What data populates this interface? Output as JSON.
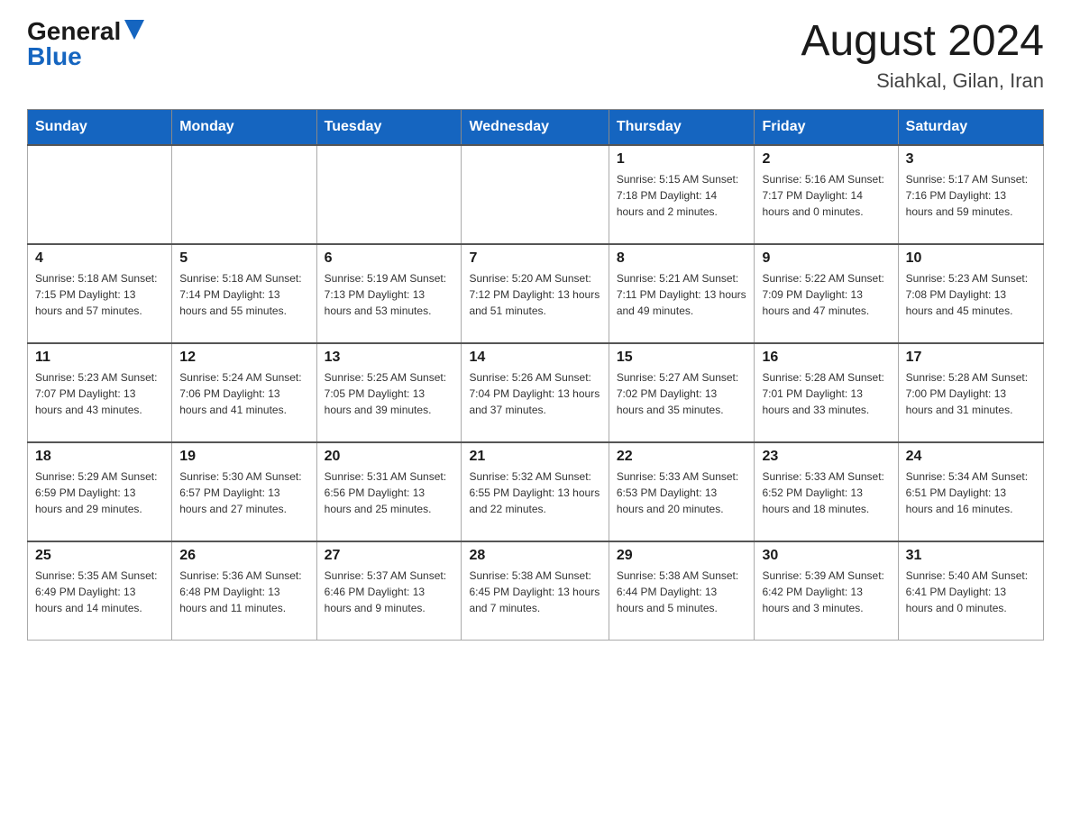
{
  "header": {
    "logo": {
      "general": "General",
      "blue": "Blue"
    },
    "title": "August 2024",
    "location": "Siahkal, Gilan, Iran"
  },
  "days_of_week": [
    "Sunday",
    "Monday",
    "Tuesday",
    "Wednesday",
    "Thursday",
    "Friday",
    "Saturday"
  ],
  "weeks": [
    [
      {
        "day": "",
        "info": ""
      },
      {
        "day": "",
        "info": ""
      },
      {
        "day": "",
        "info": ""
      },
      {
        "day": "",
        "info": ""
      },
      {
        "day": "1",
        "info": "Sunrise: 5:15 AM\nSunset: 7:18 PM\nDaylight: 14 hours\nand 2 minutes."
      },
      {
        "day": "2",
        "info": "Sunrise: 5:16 AM\nSunset: 7:17 PM\nDaylight: 14 hours\nand 0 minutes."
      },
      {
        "day": "3",
        "info": "Sunrise: 5:17 AM\nSunset: 7:16 PM\nDaylight: 13 hours\nand 59 minutes."
      }
    ],
    [
      {
        "day": "4",
        "info": "Sunrise: 5:18 AM\nSunset: 7:15 PM\nDaylight: 13 hours\nand 57 minutes."
      },
      {
        "day": "5",
        "info": "Sunrise: 5:18 AM\nSunset: 7:14 PM\nDaylight: 13 hours\nand 55 minutes."
      },
      {
        "day": "6",
        "info": "Sunrise: 5:19 AM\nSunset: 7:13 PM\nDaylight: 13 hours\nand 53 minutes."
      },
      {
        "day": "7",
        "info": "Sunrise: 5:20 AM\nSunset: 7:12 PM\nDaylight: 13 hours\nand 51 minutes."
      },
      {
        "day": "8",
        "info": "Sunrise: 5:21 AM\nSunset: 7:11 PM\nDaylight: 13 hours\nand 49 minutes."
      },
      {
        "day": "9",
        "info": "Sunrise: 5:22 AM\nSunset: 7:09 PM\nDaylight: 13 hours\nand 47 minutes."
      },
      {
        "day": "10",
        "info": "Sunrise: 5:23 AM\nSunset: 7:08 PM\nDaylight: 13 hours\nand 45 minutes."
      }
    ],
    [
      {
        "day": "11",
        "info": "Sunrise: 5:23 AM\nSunset: 7:07 PM\nDaylight: 13 hours\nand 43 minutes."
      },
      {
        "day": "12",
        "info": "Sunrise: 5:24 AM\nSunset: 7:06 PM\nDaylight: 13 hours\nand 41 minutes."
      },
      {
        "day": "13",
        "info": "Sunrise: 5:25 AM\nSunset: 7:05 PM\nDaylight: 13 hours\nand 39 minutes."
      },
      {
        "day": "14",
        "info": "Sunrise: 5:26 AM\nSunset: 7:04 PM\nDaylight: 13 hours\nand 37 minutes."
      },
      {
        "day": "15",
        "info": "Sunrise: 5:27 AM\nSunset: 7:02 PM\nDaylight: 13 hours\nand 35 minutes."
      },
      {
        "day": "16",
        "info": "Sunrise: 5:28 AM\nSunset: 7:01 PM\nDaylight: 13 hours\nand 33 minutes."
      },
      {
        "day": "17",
        "info": "Sunrise: 5:28 AM\nSunset: 7:00 PM\nDaylight: 13 hours\nand 31 minutes."
      }
    ],
    [
      {
        "day": "18",
        "info": "Sunrise: 5:29 AM\nSunset: 6:59 PM\nDaylight: 13 hours\nand 29 minutes."
      },
      {
        "day": "19",
        "info": "Sunrise: 5:30 AM\nSunset: 6:57 PM\nDaylight: 13 hours\nand 27 minutes."
      },
      {
        "day": "20",
        "info": "Sunrise: 5:31 AM\nSunset: 6:56 PM\nDaylight: 13 hours\nand 25 minutes."
      },
      {
        "day": "21",
        "info": "Sunrise: 5:32 AM\nSunset: 6:55 PM\nDaylight: 13 hours\nand 22 minutes."
      },
      {
        "day": "22",
        "info": "Sunrise: 5:33 AM\nSunset: 6:53 PM\nDaylight: 13 hours\nand 20 minutes."
      },
      {
        "day": "23",
        "info": "Sunrise: 5:33 AM\nSunset: 6:52 PM\nDaylight: 13 hours\nand 18 minutes."
      },
      {
        "day": "24",
        "info": "Sunrise: 5:34 AM\nSunset: 6:51 PM\nDaylight: 13 hours\nand 16 minutes."
      }
    ],
    [
      {
        "day": "25",
        "info": "Sunrise: 5:35 AM\nSunset: 6:49 PM\nDaylight: 13 hours\nand 14 minutes."
      },
      {
        "day": "26",
        "info": "Sunrise: 5:36 AM\nSunset: 6:48 PM\nDaylight: 13 hours\nand 11 minutes."
      },
      {
        "day": "27",
        "info": "Sunrise: 5:37 AM\nSunset: 6:46 PM\nDaylight: 13 hours\nand 9 minutes."
      },
      {
        "day": "28",
        "info": "Sunrise: 5:38 AM\nSunset: 6:45 PM\nDaylight: 13 hours\nand 7 minutes."
      },
      {
        "day": "29",
        "info": "Sunrise: 5:38 AM\nSunset: 6:44 PM\nDaylight: 13 hours\nand 5 minutes."
      },
      {
        "day": "30",
        "info": "Sunrise: 5:39 AM\nSunset: 6:42 PM\nDaylight: 13 hours\nand 3 minutes."
      },
      {
        "day": "31",
        "info": "Sunrise: 5:40 AM\nSunset: 6:41 PM\nDaylight: 13 hours\nand 0 minutes."
      }
    ]
  ]
}
